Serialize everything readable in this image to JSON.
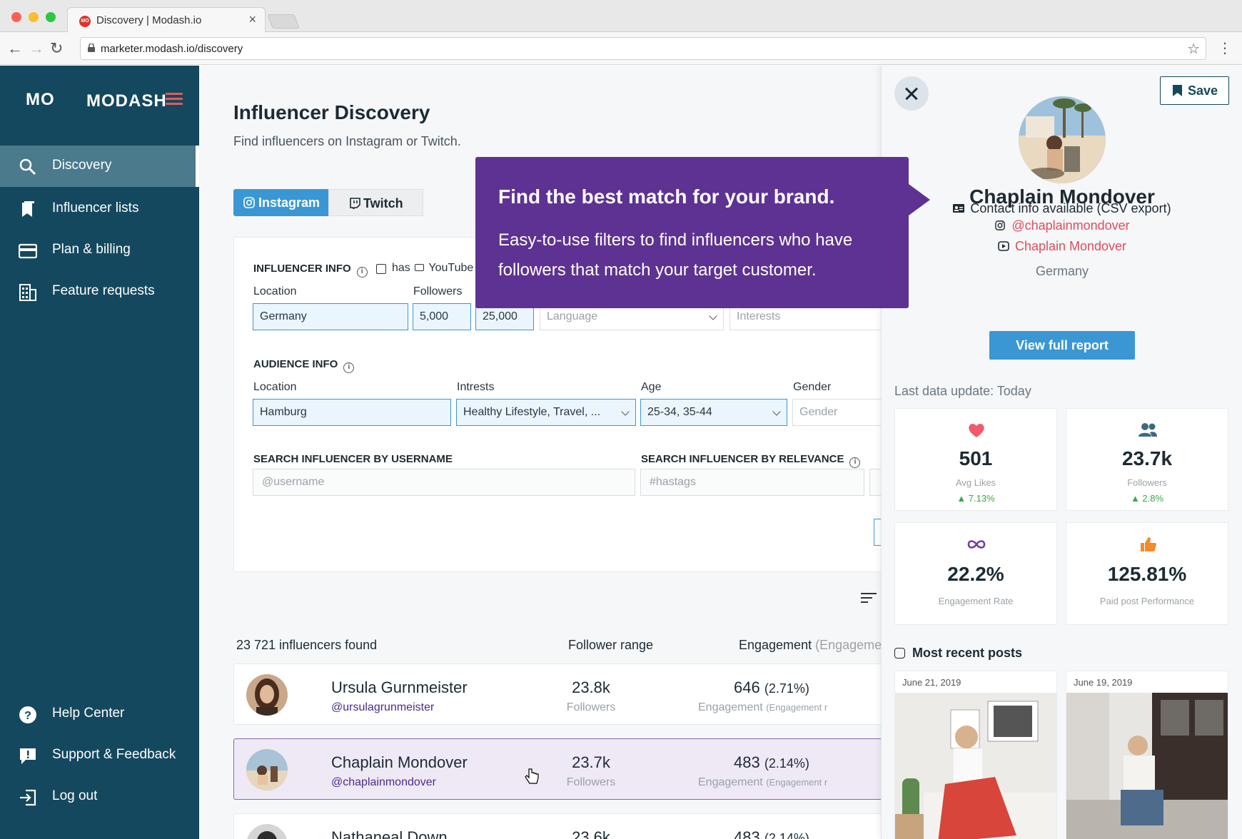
{
  "browser": {
    "tab_title": "Discovery | Modash.io",
    "url": "marketer.modash.io/discovery",
    "favicon_text": "MO"
  },
  "sidebar": {
    "brand_mark": "MO",
    "brand_name": "MODASH",
    "items": [
      {
        "label": "Discovery",
        "icon": "search-icon",
        "active": true
      },
      {
        "label": "Influencer lists",
        "icon": "bookmark-book-icon"
      },
      {
        "label": "Plan & billing",
        "icon": "credit-card-icon"
      },
      {
        "label": "Feature requests",
        "icon": "building-icon"
      }
    ],
    "bottom_items": [
      {
        "label": "Help Center",
        "icon": "question-circle-icon"
      },
      {
        "label": "Support & Feedback",
        "icon": "feedback-bubble-icon"
      },
      {
        "label": "Log out",
        "icon": "logout-icon"
      }
    ],
    "colors": {
      "background": "#14485e",
      "active": "#4a7a8c",
      "hamburger": "#e25a5a"
    }
  },
  "main": {
    "title": "Influencer Discovery",
    "subtitle": "Find influencers on Instagram or Twitch.",
    "platform_tabs": [
      {
        "label": "Instagram",
        "icon": "instagram-icon",
        "active": true
      },
      {
        "label": "Twitch",
        "icon": "twitch-icon",
        "active": false
      }
    ],
    "influencer_info": {
      "heading": "INFLUENCER INFO",
      "checkbox_label": "has",
      "checkbox_platform": "YouTube",
      "location_label": "Location",
      "location_value": "Germany",
      "followers_label": "Followers",
      "followers_min": "5,000",
      "followers_max": "25,000",
      "language_placeholder": "Language",
      "interests_placeholder": "Interests"
    },
    "audience_info": {
      "heading": "AUDIENCE INFO",
      "location_label": "Location",
      "location_value": "Hamburg",
      "interests_label": "Intrests",
      "interests_value": "Healthy Lifestyle, Travel, ...",
      "age_label": "Age",
      "age_value": "25-34, 35-44",
      "gender_label": "Gender",
      "gender_placeholder": "Gender"
    },
    "search": {
      "username_heading": "SEARCH INFLUENCER BY USERNAME",
      "username_placeholder": "@username",
      "relevance_heading": "SEARCH INFLUENCER BY RELEVANCE",
      "relevance_placeholder": "#hastags"
    },
    "results": {
      "count_text": "23 721 influencers found",
      "col_followers": "Follower range",
      "col_engagement": "Engagement",
      "col_engagement_muted": "(Engageme",
      "rows": [
        {
          "name": "Ursula Gurnmeister",
          "handle": "@ursulagrunmeister",
          "followers": "23.8k",
          "followers_label": "Followers",
          "engagement": "646",
          "engagement_rate": "(2.71%)",
          "engagement_label": "Engagement",
          "engagement_label_muted": "(Engagement r"
        },
        {
          "name": "Chaplain Mondover",
          "handle": "@chaplainmondover",
          "followers": "23.7k",
          "followers_label": "Followers",
          "engagement": "483",
          "engagement_rate": "(2.14%)",
          "engagement_label": "Engagement",
          "engagement_label_muted": "(Engagement r",
          "selected": true
        },
        {
          "name": "Nathaneal Down",
          "handle": "",
          "followers": "23.6k",
          "followers_label": "",
          "engagement": "483",
          "engagement_rate": "(2.14%)",
          "engagement_label": "",
          "engagement_label_muted": ""
        }
      ]
    }
  },
  "callout": {
    "title": "Find the best match for your brand.",
    "body": "Easy-to-use filters to find influencers who have followers that match your target customer.",
    "color": "#5e3292"
  },
  "panel": {
    "save_label": "Save",
    "name": "Chaplain Mondover",
    "contact_text": "Contact info available (CSV export)",
    "instagram_handle": "@chaplainmondover",
    "youtube_name": "Chaplain Mondover",
    "country": "Germany",
    "report_button": "View full report",
    "last_update": "Last data update: Today",
    "stats": [
      {
        "icon": "heart-icon",
        "value": "501",
        "label": "Avg Likes",
        "delta": "7.13%"
      },
      {
        "icon": "people-icon",
        "value": "23.7k",
        "label": "Followers",
        "delta": "2.8%"
      },
      {
        "icon": "infinity-icon",
        "value": "22.2%",
        "label": "Engagement Rate",
        "delta": ""
      },
      {
        "icon": "thumbs-up-icon",
        "value": "125.81%",
        "label": "Paid post Performance",
        "delta": ""
      }
    ],
    "recent_heading": "Most recent posts",
    "posts": [
      {
        "date": "June 21, 2019"
      },
      {
        "date": "June 19, 2019"
      }
    ]
  }
}
